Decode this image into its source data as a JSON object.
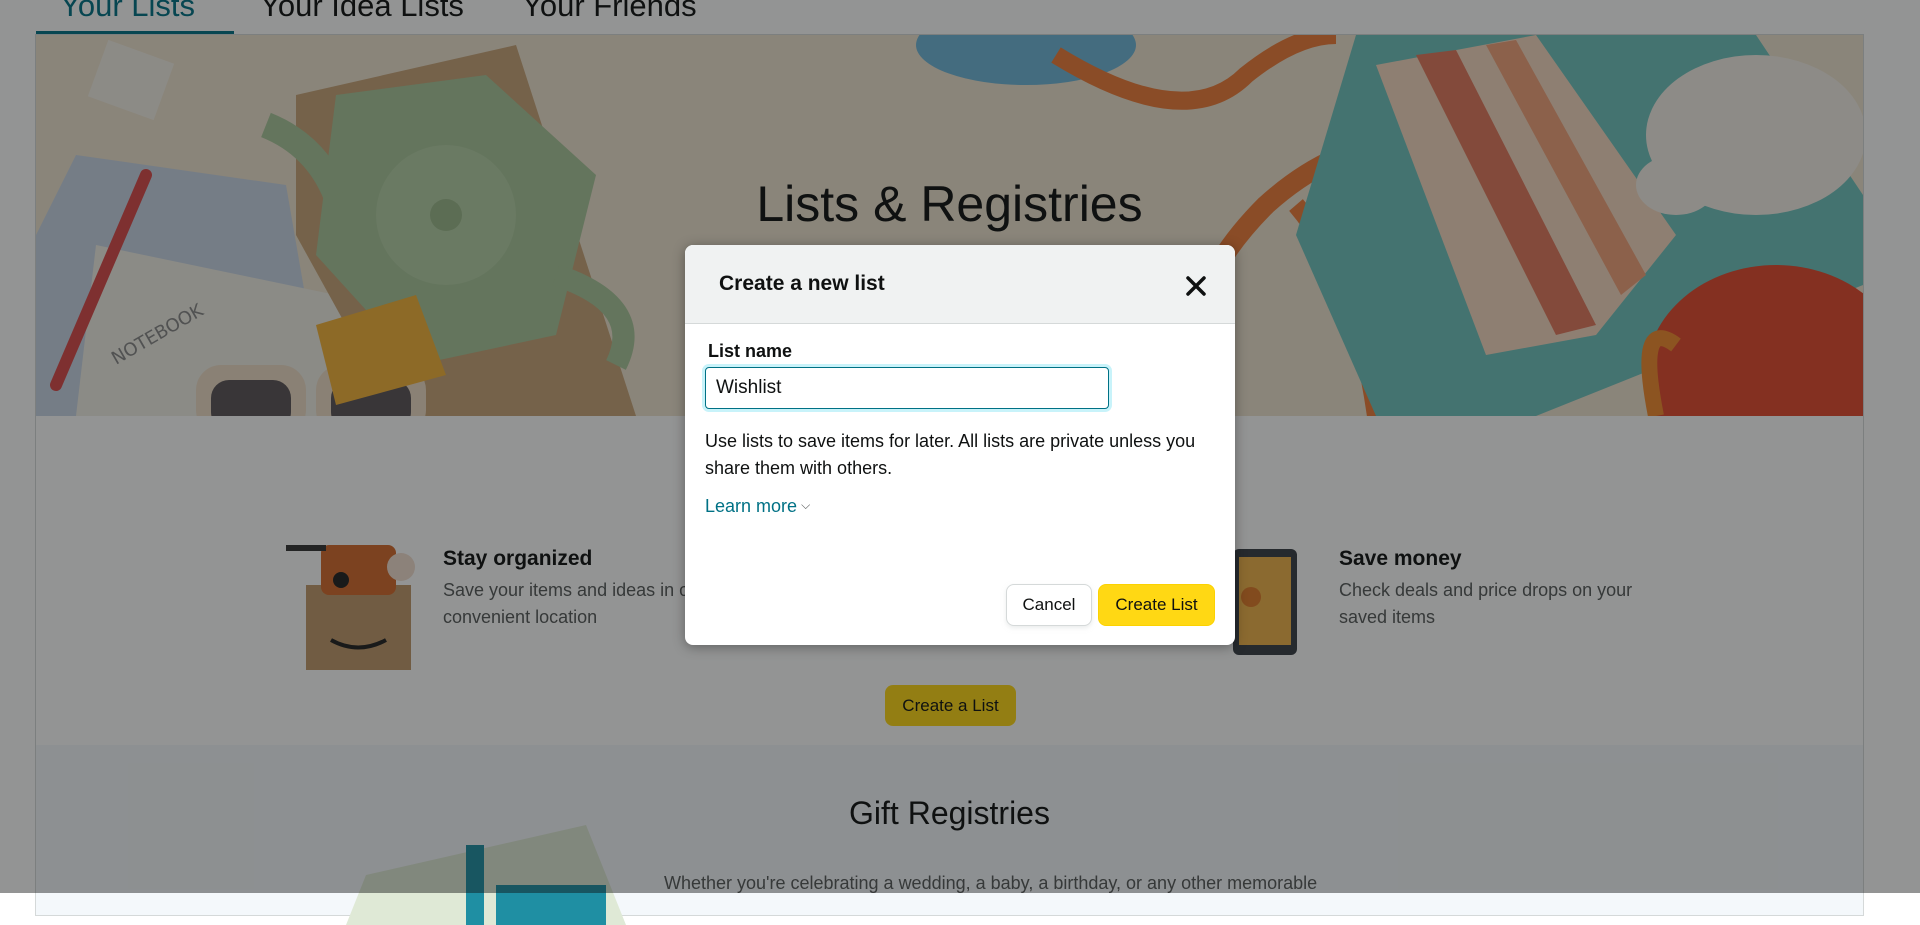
{
  "tabs": [
    "Your Lists",
    "Your Idea Lists",
    "Your Friends"
  ],
  "hero": {
    "title": "Lists & Registries"
  },
  "features": [
    {
      "title": "Stay organized",
      "text": "Save your items and ideas in one convenient location"
    },
    {
      "title": "Save money",
      "text": "Check deals and price drops on your saved items"
    }
  ],
  "create_a_list_label": "Create a List",
  "gift": {
    "title": "Gift Registries",
    "text": "Whether you're celebrating a wedding, a baby, a birthday, or any other memorable"
  },
  "modal": {
    "title": "Create a new list",
    "field_label": "List name",
    "field_value": "Wishlist",
    "help_text": "Use lists to save items for later. All lists are private unless you share them with others.",
    "learn_more": "Learn more",
    "cancel_label": "Cancel",
    "create_label": "Create List"
  },
  "colors": {
    "accent": "#007185",
    "primary_button": "#ffd814",
    "overlay": "rgba(15,17,17,0.45)"
  }
}
